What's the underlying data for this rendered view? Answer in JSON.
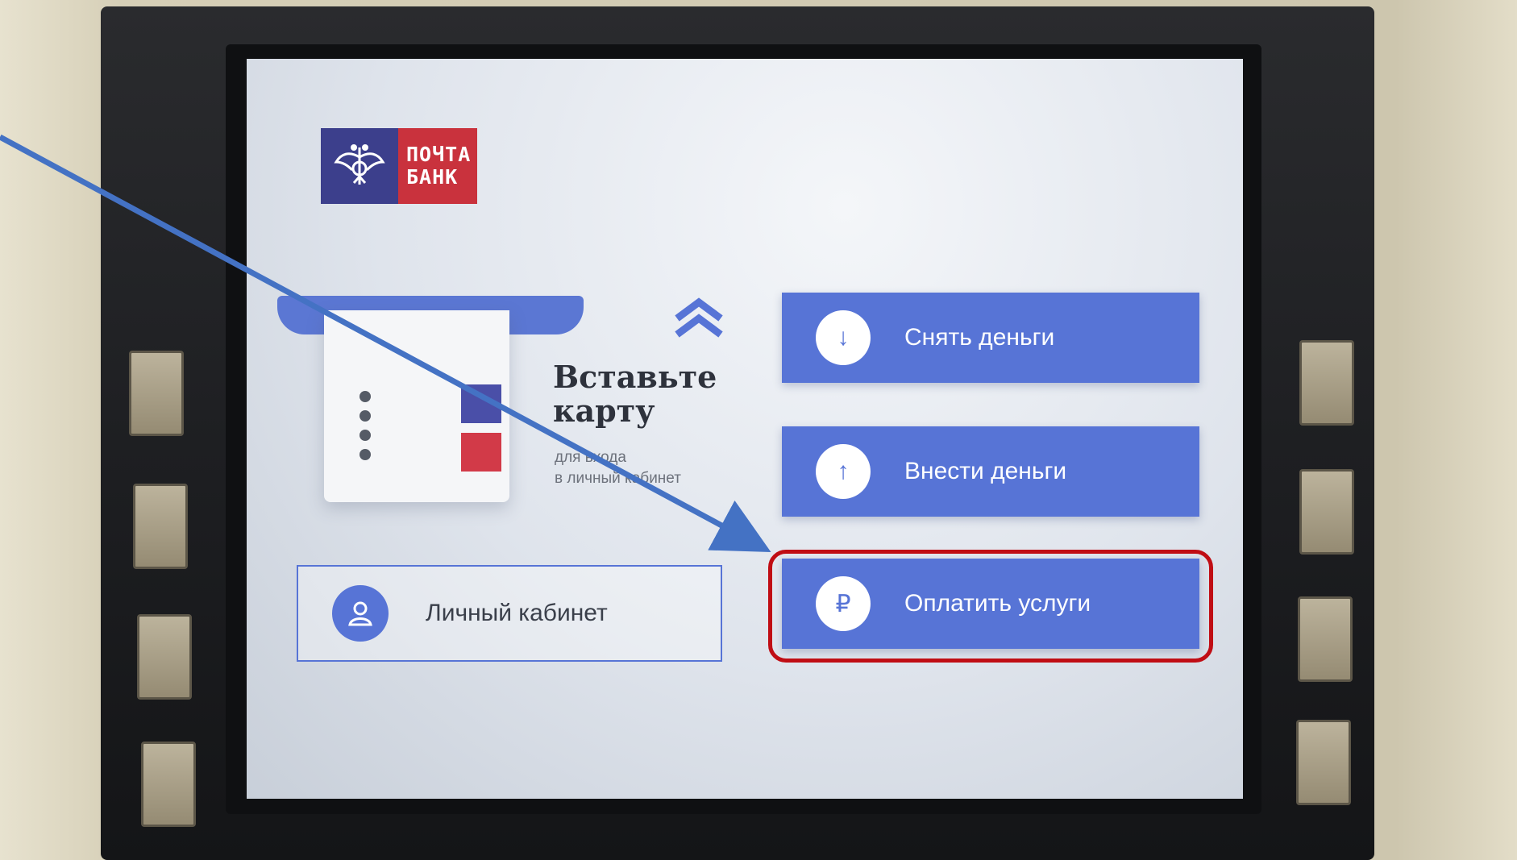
{
  "logo": {
    "line1": "ПОЧТА",
    "line2": "БАНК"
  },
  "insert_card": {
    "title_line1": "Вставьте",
    "title_line2": "карту",
    "subtitle_line1": "для входа",
    "subtitle_line2": "в личный кабинет"
  },
  "buttons": [
    {
      "label": "Снять деньги",
      "icon": "arrow-down-icon",
      "glyph": "↓"
    },
    {
      "label": "Внести деньги",
      "icon": "arrow-up-icon",
      "glyph": "↑"
    },
    {
      "label": "Оплатить услуги",
      "icon": "ruble-icon",
      "glyph": "₽"
    }
  ],
  "personal_account": {
    "label": "Личный кабинет",
    "icon": "user-icon"
  },
  "colors": {
    "accent": "#5774d6",
    "logo_blue": "#3c3f8c",
    "logo_red": "#c9323d",
    "annotation_arrow": "#4472c4",
    "highlight": "#c00d14"
  }
}
